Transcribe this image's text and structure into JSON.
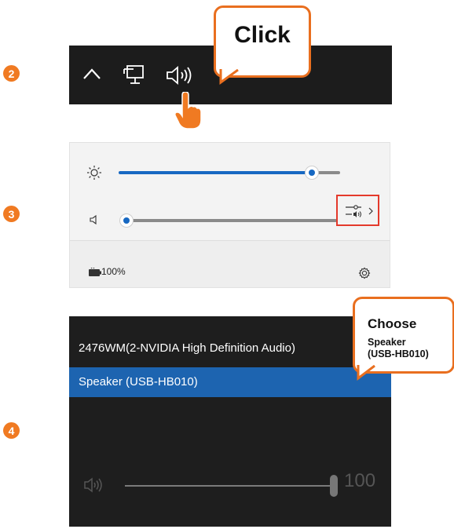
{
  "steps": {
    "s2": "2",
    "s3": "3",
    "s4": "4"
  },
  "step2": {
    "callout_text": "Click",
    "icons": [
      "chevron-up-icon",
      "network-icon",
      "speaker-icon",
      "pointer-hand-icon"
    ]
  },
  "step3": {
    "brightness_level": 0.87,
    "volume_level": 0.0,
    "battery_text": "100%",
    "icons": [
      "brightness-icon",
      "speaker-mute-icon",
      "audio-output-icon",
      "chevron-right-icon",
      "battery-icon",
      "gear-icon"
    ]
  },
  "step4": {
    "devices": [
      "2476WM(2-NVIDIA High Definition Audio)",
      "Speaker (USB-HB010)"
    ],
    "selected_device": "Speaker (USB-HB010)",
    "volume_value": "100",
    "callout_title": "Choose",
    "callout_detail": "Speaker\n(USB-HB010)"
  },
  "colors": {
    "accent": "#f07a22",
    "slider": "#1768c2",
    "selected": "#1d64b0",
    "highlight": "#e4392b"
  }
}
